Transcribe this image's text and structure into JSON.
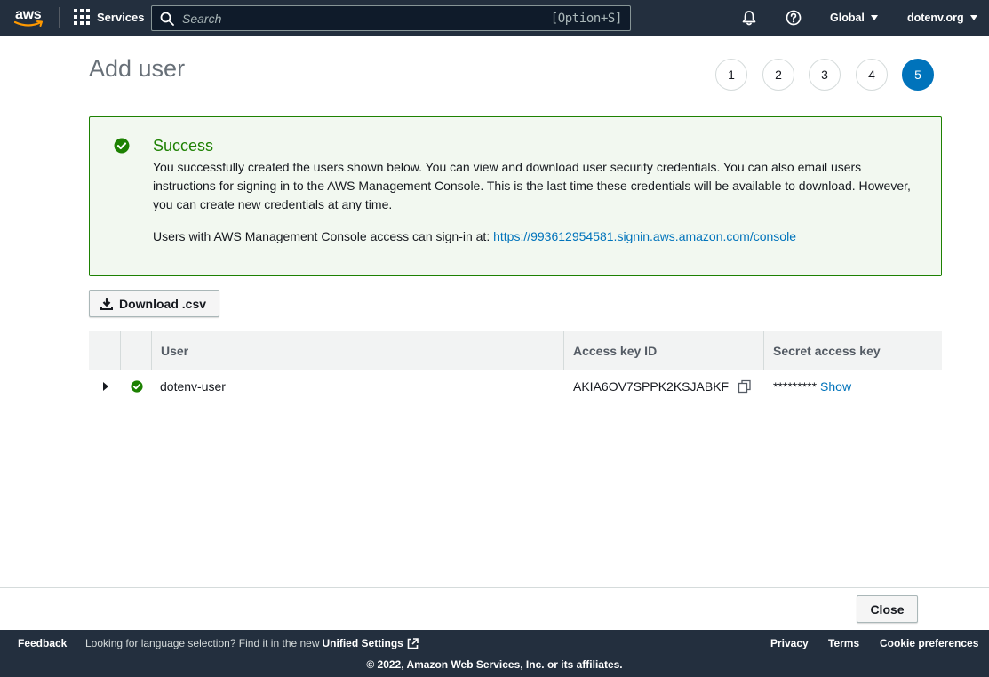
{
  "topnav": {
    "logo_text": "aws",
    "services_label": "Services",
    "search_placeholder": "Search",
    "search_shortcut": "[Option+S]",
    "region_label": "Global",
    "account_label": "dotenv.org"
  },
  "header": {
    "title": "Add user",
    "steps": [
      "1",
      "2",
      "3",
      "4",
      "5"
    ],
    "active_step": "5"
  },
  "success": {
    "title": "Success",
    "message": "You successfully created the users shown below. You can view and download user security credentials. You can also email users instructions for signing in to the AWS Management Console. This is the last time these credentials will be available to download. However, you can create new credentials at any time.",
    "signin_prefix": "Users with AWS Management Console access can sign-in at: ",
    "signin_url": "https://993612954581.signin.aws.amazon.com/console"
  },
  "download_button": "Download .csv",
  "table": {
    "columns": [
      "User",
      "Access key ID",
      "Secret access key"
    ],
    "rows": [
      {
        "user": "dotenv-user",
        "access_key_id": "AKIA6OV7SPPK2KSJABKF",
        "secret_masked": "*********",
        "show_label": "Show"
      }
    ]
  },
  "close_button": "Close",
  "footer": {
    "feedback": "Feedback",
    "lang_text": "Looking for language selection? Find it in the new",
    "unified_settings": "Unified Settings",
    "privacy": "Privacy",
    "terms": "Terms",
    "cookie_prefs": "Cookie preferences",
    "copyright": "© 2022, Amazon Web Services, Inc. or its affiliates."
  },
  "colors": {
    "nav_bg": "#232f3e",
    "accent": "#0073bb",
    "success": "#1d8102",
    "success_bg": "#f2f8f0"
  }
}
